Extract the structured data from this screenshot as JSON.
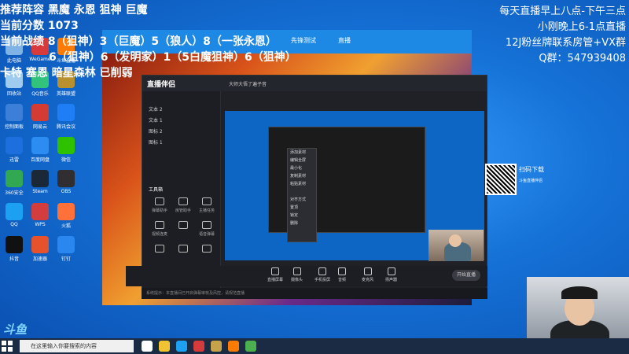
{
  "overlay_left": {
    "line1": "推荐阵容  黑魔 永恩 狙神 巨魔",
    "line2": "当前分数   1073",
    "line3": "当前战绩  8（狙神）3（巨魔）5（狼人）8（一张永恩）",
    "line4": "6（狙神）6（发明家）1（5白魔狙神）6（狙神）",
    "line5": "卡特 塞恩 暗星森林 已削弱"
  },
  "overlay_right": {
    "line1": "每天直播早上八点-下午三点",
    "line2": "小刚晚上6-1点直播",
    "line3": "12J粉丝牌联系房管+VX群",
    "line4": "Q群：547939408"
  },
  "stream_tabs": [
    "先锋测试",
    "直播"
  ],
  "app": {
    "logo": "直播伴侣",
    "top_title": "大师大悟了遍子音",
    "scenes": [
      "文本 2",
      "文本 1",
      "图标 2",
      "图标 1"
    ],
    "tools_header": "工具箱",
    "tools": [
      "弹幕助手",
      "房管助手",
      "主播任务",
      "视频连麦",
      "",
      "语音弹幕",
      "",
      "",
      "",
      "",
      "",
      ""
    ],
    "context_menu": [
      "添加素材",
      "编辑全屏",
      "最小化",
      "复制素材",
      "粘贴素材",
      "",
      "对齐方式",
      "置顶",
      "锁定",
      "删除"
    ],
    "bottom": [
      "直播屏幕",
      "摄像头",
      "手机投屏",
      "音频",
      "麦克风",
      "扬声器"
    ],
    "start_live": "开始直播",
    "status": "系统提示：本直播间已开启弹幕审核及风控，请规范直播"
  },
  "qr": {
    "label": "扫码下载",
    "sub": "斗鱼直播伴侣"
  },
  "douyu_logo": "斗鱼",
  "taskbar": {
    "search_placeholder": "在这里输入你要搜索的内容"
  },
  "desktop_icons": [
    {
      "label": "此电脑",
      "color": "#7fb2e5"
    },
    {
      "label": "WeGame",
      "color": "#d63a3a"
    },
    {
      "label": "斗鱼直播",
      "color": "#ff7a00"
    },
    {
      "label": "回收站",
      "color": "#9ecbee"
    },
    {
      "label": "QQ音乐",
      "color": "#31c27c"
    },
    {
      "label": "英雄联盟",
      "color": "#b8902e"
    },
    {
      "label": "控制面板",
      "color": "#3b7fd9"
    },
    {
      "label": "网易云",
      "color": "#d43c33"
    },
    {
      "label": "腾讯会议",
      "color": "#1f7ef6"
    },
    {
      "label": "迅雷",
      "color": "#1e6fde"
    },
    {
      "label": "百度网盘",
      "color": "#2c8cf2"
    },
    {
      "label": "微信",
      "color": "#2dc100"
    },
    {
      "label": "360安全",
      "color": "#32a852"
    },
    {
      "label": "Steam",
      "color": "#1b2838"
    },
    {
      "label": "OBS",
      "color": "#302e31"
    },
    {
      "label": "QQ",
      "color": "#1ba0f2"
    },
    {
      "label": "WPS",
      "color": "#d43d3d"
    },
    {
      "label": "火狐",
      "color": "#ff7139"
    },
    {
      "label": "抖音",
      "color": "#111111"
    },
    {
      "label": "加速器",
      "color": "#e6522c"
    },
    {
      "label": "钉钉",
      "color": "#2a87f0"
    }
  ],
  "taskbar_apps": [
    {
      "name": "task-view",
      "color": "#ffffff"
    },
    {
      "name": "explorer",
      "color": "#f1c232"
    },
    {
      "name": "edge",
      "color": "#1da1f2"
    },
    {
      "name": "wegame",
      "color": "#d63a3a"
    },
    {
      "name": "lol",
      "color": "#c8a24a"
    },
    {
      "name": "douyu",
      "color": "#ff7a00"
    },
    {
      "name": "chrome",
      "color": "#4caf50"
    }
  ]
}
